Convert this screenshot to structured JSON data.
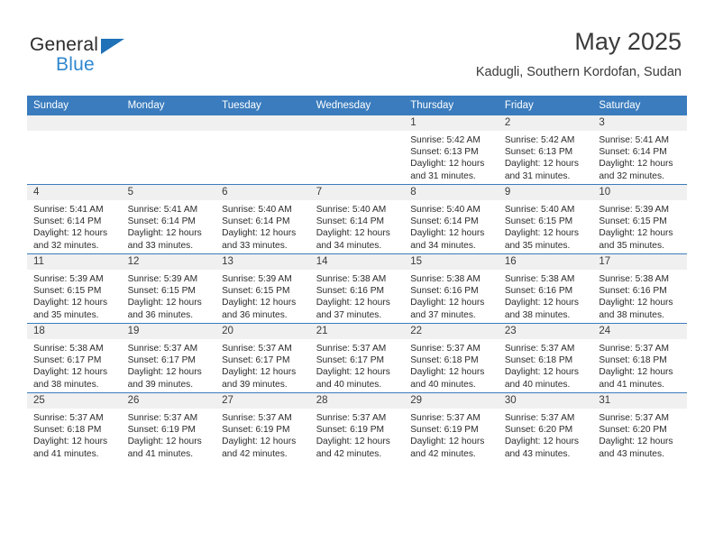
{
  "branding": {
    "logo_text_primary": "General",
    "logo_text_secondary": "Blue",
    "accent_color": "#2f87cf",
    "triangle_color": "#1f71b8"
  },
  "header": {
    "title": "May 2025",
    "location": "Kadugli, Southern Kordofan, Sudan"
  },
  "theme": {
    "header_row_color": "#3a7cbe",
    "daynum_band_color": "#f0f0f0",
    "text_color": "#2b2b2b"
  },
  "columns": [
    "Sunday",
    "Monday",
    "Tuesday",
    "Wednesday",
    "Thursday",
    "Friday",
    "Saturday"
  ],
  "weeks": [
    [
      {
        "day": "",
        "empty": true
      },
      {
        "day": "",
        "empty": true
      },
      {
        "day": "",
        "empty": true
      },
      {
        "day": "",
        "empty": true
      },
      {
        "day": "1",
        "sunrise": "Sunrise: 5:42 AM",
        "sunset": "Sunset: 6:13 PM",
        "daylight_line1": "Daylight: 12 hours",
        "daylight_line2": "and 31 minutes."
      },
      {
        "day": "2",
        "sunrise": "Sunrise: 5:42 AM",
        "sunset": "Sunset: 6:13 PM",
        "daylight_line1": "Daylight: 12 hours",
        "daylight_line2": "and 31 minutes."
      },
      {
        "day": "3",
        "sunrise": "Sunrise: 5:41 AM",
        "sunset": "Sunset: 6:14 PM",
        "daylight_line1": "Daylight: 12 hours",
        "daylight_line2": "and 32 minutes."
      }
    ],
    [
      {
        "day": "4",
        "sunrise": "Sunrise: 5:41 AM",
        "sunset": "Sunset: 6:14 PM",
        "daylight_line1": "Daylight: 12 hours",
        "daylight_line2": "and 32 minutes."
      },
      {
        "day": "5",
        "sunrise": "Sunrise: 5:41 AM",
        "sunset": "Sunset: 6:14 PM",
        "daylight_line1": "Daylight: 12 hours",
        "daylight_line2": "and 33 minutes."
      },
      {
        "day": "6",
        "sunrise": "Sunrise: 5:40 AM",
        "sunset": "Sunset: 6:14 PM",
        "daylight_line1": "Daylight: 12 hours",
        "daylight_line2": "and 33 minutes."
      },
      {
        "day": "7",
        "sunrise": "Sunrise: 5:40 AM",
        "sunset": "Sunset: 6:14 PM",
        "daylight_line1": "Daylight: 12 hours",
        "daylight_line2": "and 34 minutes."
      },
      {
        "day": "8",
        "sunrise": "Sunrise: 5:40 AM",
        "sunset": "Sunset: 6:14 PM",
        "daylight_line1": "Daylight: 12 hours",
        "daylight_line2": "and 34 minutes."
      },
      {
        "day": "9",
        "sunrise": "Sunrise: 5:40 AM",
        "sunset": "Sunset: 6:15 PM",
        "daylight_line1": "Daylight: 12 hours",
        "daylight_line2": "and 35 minutes."
      },
      {
        "day": "10",
        "sunrise": "Sunrise: 5:39 AM",
        "sunset": "Sunset: 6:15 PM",
        "daylight_line1": "Daylight: 12 hours",
        "daylight_line2": "and 35 minutes."
      }
    ],
    [
      {
        "day": "11",
        "sunrise": "Sunrise: 5:39 AM",
        "sunset": "Sunset: 6:15 PM",
        "daylight_line1": "Daylight: 12 hours",
        "daylight_line2": "and 35 minutes."
      },
      {
        "day": "12",
        "sunrise": "Sunrise: 5:39 AM",
        "sunset": "Sunset: 6:15 PM",
        "daylight_line1": "Daylight: 12 hours",
        "daylight_line2": "and 36 minutes."
      },
      {
        "day": "13",
        "sunrise": "Sunrise: 5:39 AM",
        "sunset": "Sunset: 6:15 PM",
        "daylight_line1": "Daylight: 12 hours",
        "daylight_line2": "and 36 minutes."
      },
      {
        "day": "14",
        "sunrise": "Sunrise: 5:38 AM",
        "sunset": "Sunset: 6:16 PM",
        "daylight_line1": "Daylight: 12 hours",
        "daylight_line2": "and 37 minutes."
      },
      {
        "day": "15",
        "sunrise": "Sunrise: 5:38 AM",
        "sunset": "Sunset: 6:16 PM",
        "daylight_line1": "Daylight: 12 hours",
        "daylight_line2": "and 37 minutes."
      },
      {
        "day": "16",
        "sunrise": "Sunrise: 5:38 AM",
        "sunset": "Sunset: 6:16 PM",
        "daylight_line1": "Daylight: 12 hours",
        "daylight_line2": "and 38 minutes."
      },
      {
        "day": "17",
        "sunrise": "Sunrise: 5:38 AM",
        "sunset": "Sunset: 6:16 PM",
        "daylight_line1": "Daylight: 12 hours",
        "daylight_line2": "and 38 minutes."
      }
    ],
    [
      {
        "day": "18",
        "sunrise": "Sunrise: 5:38 AM",
        "sunset": "Sunset: 6:17 PM",
        "daylight_line1": "Daylight: 12 hours",
        "daylight_line2": "and 38 minutes."
      },
      {
        "day": "19",
        "sunrise": "Sunrise: 5:37 AM",
        "sunset": "Sunset: 6:17 PM",
        "daylight_line1": "Daylight: 12 hours",
        "daylight_line2": "and 39 minutes."
      },
      {
        "day": "20",
        "sunrise": "Sunrise: 5:37 AM",
        "sunset": "Sunset: 6:17 PM",
        "daylight_line1": "Daylight: 12 hours",
        "daylight_line2": "and 39 minutes."
      },
      {
        "day": "21",
        "sunrise": "Sunrise: 5:37 AM",
        "sunset": "Sunset: 6:17 PM",
        "daylight_line1": "Daylight: 12 hours",
        "daylight_line2": "and 40 minutes."
      },
      {
        "day": "22",
        "sunrise": "Sunrise: 5:37 AM",
        "sunset": "Sunset: 6:18 PM",
        "daylight_line1": "Daylight: 12 hours",
        "daylight_line2": "and 40 minutes."
      },
      {
        "day": "23",
        "sunrise": "Sunrise: 5:37 AM",
        "sunset": "Sunset: 6:18 PM",
        "daylight_line1": "Daylight: 12 hours",
        "daylight_line2": "and 40 minutes."
      },
      {
        "day": "24",
        "sunrise": "Sunrise: 5:37 AM",
        "sunset": "Sunset: 6:18 PM",
        "daylight_line1": "Daylight: 12 hours",
        "daylight_line2": "and 41 minutes."
      }
    ],
    [
      {
        "day": "25",
        "sunrise": "Sunrise: 5:37 AM",
        "sunset": "Sunset: 6:18 PM",
        "daylight_line1": "Daylight: 12 hours",
        "daylight_line2": "and 41 minutes."
      },
      {
        "day": "26",
        "sunrise": "Sunrise: 5:37 AM",
        "sunset": "Sunset: 6:19 PM",
        "daylight_line1": "Daylight: 12 hours",
        "daylight_line2": "and 41 minutes."
      },
      {
        "day": "27",
        "sunrise": "Sunrise: 5:37 AM",
        "sunset": "Sunset: 6:19 PM",
        "daylight_line1": "Daylight: 12 hours",
        "daylight_line2": "and 42 minutes."
      },
      {
        "day": "28",
        "sunrise": "Sunrise: 5:37 AM",
        "sunset": "Sunset: 6:19 PM",
        "daylight_line1": "Daylight: 12 hours",
        "daylight_line2": "and 42 minutes."
      },
      {
        "day": "29",
        "sunrise": "Sunrise: 5:37 AM",
        "sunset": "Sunset: 6:19 PM",
        "daylight_line1": "Daylight: 12 hours",
        "daylight_line2": "and 42 minutes."
      },
      {
        "day": "30",
        "sunrise": "Sunrise: 5:37 AM",
        "sunset": "Sunset: 6:20 PM",
        "daylight_line1": "Daylight: 12 hours",
        "daylight_line2": "and 43 minutes."
      },
      {
        "day": "31",
        "sunrise": "Sunrise: 5:37 AM",
        "sunset": "Sunset: 6:20 PM",
        "daylight_line1": "Daylight: 12 hours",
        "daylight_line2": "and 43 minutes."
      }
    ]
  ]
}
